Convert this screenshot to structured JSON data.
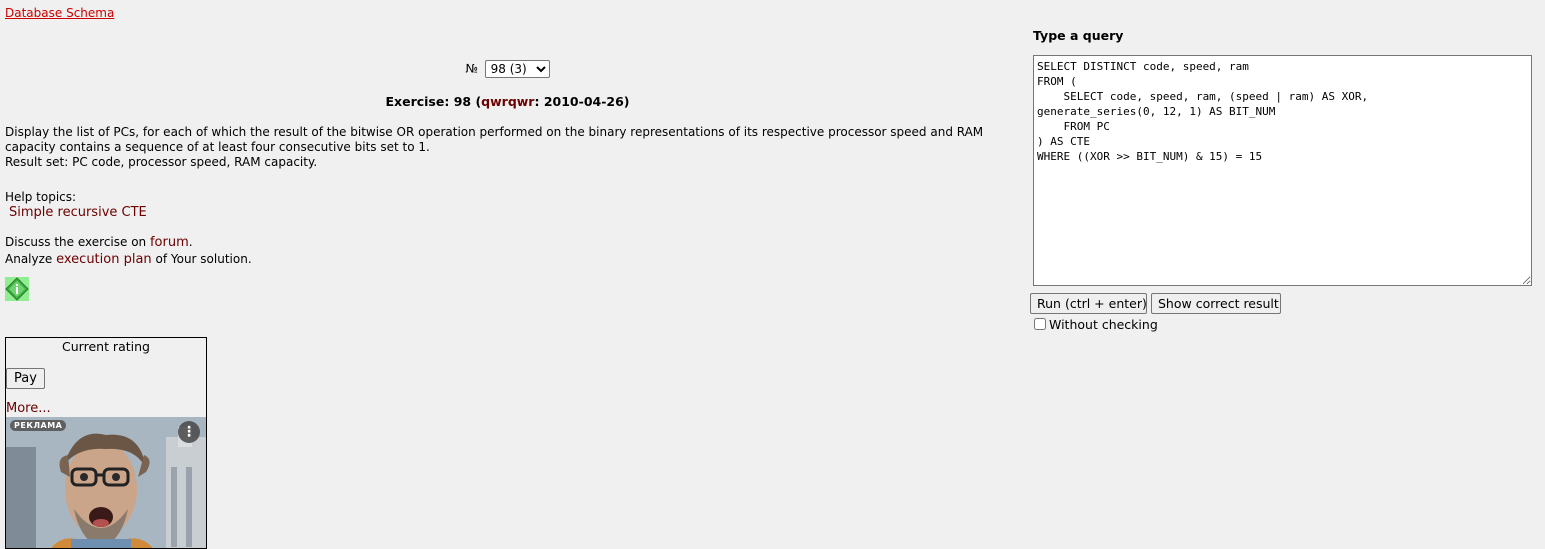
{
  "schema_link": "Database Schema",
  "exercise": {
    "number_label": "№",
    "selected": "98 (3)",
    "title_prefix": "Exercise: 98 (",
    "author": "qwrqwr",
    "title_suffix": ": 2010-04-26)",
    "task_line1": "Display the list of PCs, for each of which the result of the bitwise OR operation performed on the binary representations of its respective processor speed and RAM",
    "task_line2": "capacity contains a sequence of at least four consecutive bits set to 1.",
    "task_line3": "Result set: PC code, processor speed, RAM capacity.",
    "help_label": "Help topics:",
    "help_link": "Simple recursive CTE",
    "discuss_prefix": "Discuss the exercise on ",
    "forum_link": "forum",
    "discuss_suffix": ".",
    "analyze_prefix": "Analyze ",
    "plan_link": "execution plan",
    "analyze_suffix": " of Your solution.",
    "info_icon": "diamond-info-icon"
  },
  "rating": {
    "title": "Current rating",
    "pay_label": "Pay",
    "more_label": "More...",
    "ad_badge": "РЕКЛАМА",
    "ad_menu": "⋮"
  },
  "query": {
    "label": "Type a query",
    "text": "SELECT DISTINCT code, speed, ram\nFROM (\n    SELECT code, speed, ram, (speed | ram) AS XOR,\ngenerate_series(0, 12, 1) AS BIT_NUM\n    FROM PC\n) AS CTE\nWHERE ((XOR >> BIT_NUM) & 15) = 15",
    "run_label": "Run (ctrl + enter)",
    "show_label": "Show correct result",
    "nocheck_label": "Without checking",
    "nocheck_checked": false
  }
}
